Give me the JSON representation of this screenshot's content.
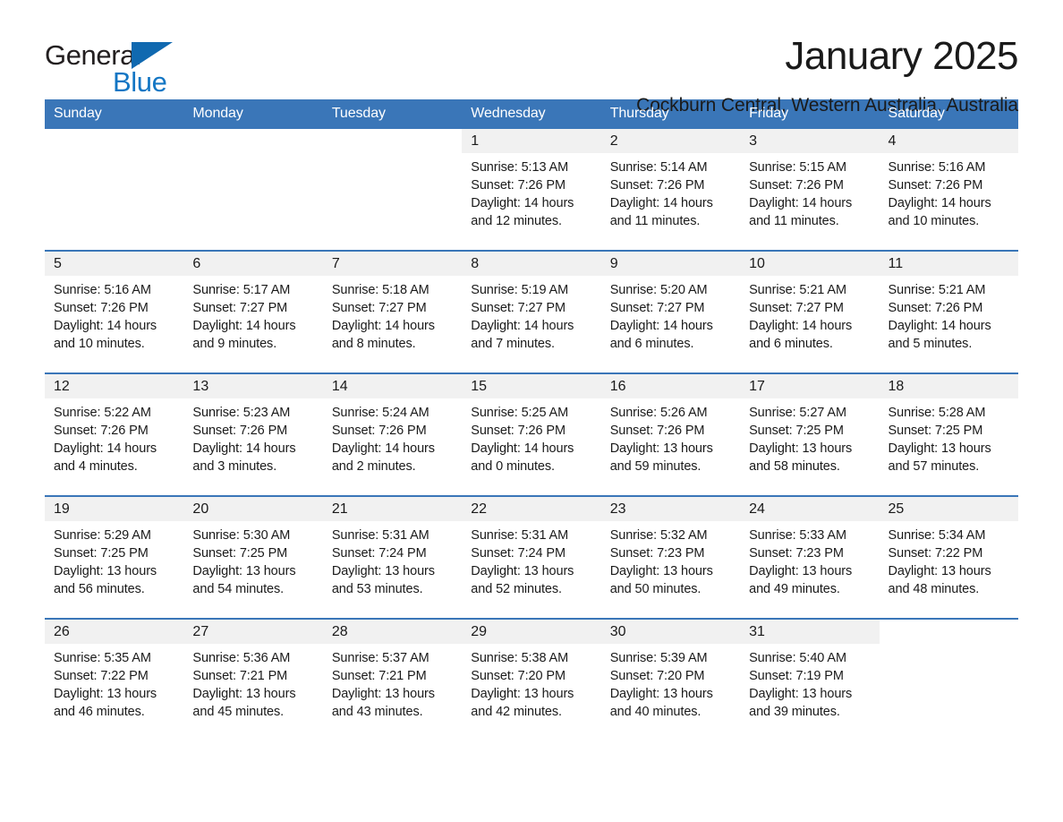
{
  "brand": {
    "name_part1": "General",
    "name_part2": "Blue",
    "accent_color": "#1376c4",
    "triangle_color": "#1069b0"
  },
  "header": {
    "title": "January 2025",
    "location": "Cockburn Central, Western Australia, Australia"
  },
  "calendar": {
    "header_bg": "#3a76b8",
    "daynum_bg": "#f1f1f1",
    "weekday_headers": [
      "Sunday",
      "Monday",
      "Tuesday",
      "Wednesday",
      "Thursday",
      "Friday",
      "Saturday"
    ],
    "weeks": [
      [
        {
          "day": "",
          "blank": true
        },
        {
          "day": "",
          "blank": true
        },
        {
          "day": "",
          "blank": true
        },
        {
          "day": "1",
          "sunrise": "Sunrise: 5:13 AM",
          "sunset": "Sunset: 7:26 PM",
          "daylight_line1": "Daylight: 14 hours",
          "daylight_line2": "and 12 minutes."
        },
        {
          "day": "2",
          "sunrise": "Sunrise: 5:14 AM",
          "sunset": "Sunset: 7:26 PM",
          "daylight_line1": "Daylight: 14 hours",
          "daylight_line2": "and 11 minutes."
        },
        {
          "day": "3",
          "sunrise": "Sunrise: 5:15 AM",
          "sunset": "Sunset: 7:26 PM",
          "daylight_line1": "Daylight: 14 hours",
          "daylight_line2": "and 11 minutes."
        },
        {
          "day": "4",
          "sunrise": "Sunrise: 5:16 AM",
          "sunset": "Sunset: 7:26 PM",
          "daylight_line1": "Daylight: 14 hours",
          "daylight_line2": "and 10 minutes."
        }
      ],
      [
        {
          "day": "5",
          "sunrise": "Sunrise: 5:16 AM",
          "sunset": "Sunset: 7:26 PM",
          "daylight_line1": "Daylight: 14 hours",
          "daylight_line2": "and 10 minutes."
        },
        {
          "day": "6",
          "sunrise": "Sunrise: 5:17 AM",
          "sunset": "Sunset: 7:27 PM",
          "daylight_line1": "Daylight: 14 hours",
          "daylight_line2": "and 9 minutes."
        },
        {
          "day": "7",
          "sunrise": "Sunrise: 5:18 AM",
          "sunset": "Sunset: 7:27 PM",
          "daylight_line1": "Daylight: 14 hours",
          "daylight_line2": "and 8 minutes."
        },
        {
          "day": "8",
          "sunrise": "Sunrise: 5:19 AM",
          "sunset": "Sunset: 7:27 PM",
          "daylight_line1": "Daylight: 14 hours",
          "daylight_line2": "and 7 minutes."
        },
        {
          "day": "9",
          "sunrise": "Sunrise: 5:20 AM",
          "sunset": "Sunset: 7:27 PM",
          "daylight_line1": "Daylight: 14 hours",
          "daylight_line2": "and 6 minutes."
        },
        {
          "day": "10",
          "sunrise": "Sunrise: 5:21 AM",
          "sunset": "Sunset: 7:27 PM",
          "daylight_line1": "Daylight: 14 hours",
          "daylight_line2": "and 6 minutes."
        },
        {
          "day": "11",
          "sunrise": "Sunrise: 5:21 AM",
          "sunset": "Sunset: 7:26 PM",
          "daylight_line1": "Daylight: 14 hours",
          "daylight_line2": "and 5 minutes."
        }
      ],
      [
        {
          "day": "12",
          "sunrise": "Sunrise: 5:22 AM",
          "sunset": "Sunset: 7:26 PM",
          "daylight_line1": "Daylight: 14 hours",
          "daylight_line2": "and 4 minutes."
        },
        {
          "day": "13",
          "sunrise": "Sunrise: 5:23 AM",
          "sunset": "Sunset: 7:26 PM",
          "daylight_line1": "Daylight: 14 hours",
          "daylight_line2": "and 3 minutes."
        },
        {
          "day": "14",
          "sunrise": "Sunrise: 5:24 AM",
          "sunset": "Sunset: 7:26 PM",
          "daylight_line1": "Daylight: 14 hours",
          "daylight_line2": "and 2 minutes."
        },
        {
          "day": "15",
          "sunrise": "Sunrise: 5:25 AM",
          "sunset": "Sunset: 7:26 PM",
          "daylight_line1": "Daylight: 14 hours",
          "daylight_line2": "and 0 minutes."
        },
        {
          "day": "16",
          "sunrise": "Sunrise: 5:26 AM",
          "sunset": "Sunset: 7:26 PM",
          "daylight_line1": "Daylight: 13 hours",
          "daylight_line2": "and 59 minutes."
        },
        {
          "day": "17",
          "sunrise": "Sunrise: 5:27 AM",
          "sunset": "Sunset: 7:25 PM",
          "daylight_line1": "Daylight: 13 hours",
          "daylight_line2": "and 58 minutes."
        },
        {
          "day": "18",
          "sunrise": "Sunrise: 5:28 AM",
          "sunset": "Sunset: 7:25 PM",
          "daylight_line1": "Daylight: 13 hours",
          "daylight_line2": "and 57 minutes."
        }
      ],
      [
        {
          "day": "19",
          "sunrise": "Sunrise: 5:29 AM",
          "sunset": "Sunset: 7:25 PM",
          "daylight_line1": "Daylight: 13 hours",
          "daylight_line2": "and 56 minutes."
        },
        {
          "day": "20",
          "sunrise": "Sunrise: 5:30 AM",
          "sunset": "Sunset: 7:25 PM",
          "daylight_line1": "Daylight: 13 hours",
          "daylight_line2": "and 54 minutes."
        },
        {
          "day": "21",
          "sunrise": "Sunrise: 5:31 AM",
          "sunset": "Sunset: 7:24 PM",
          "daylight_line1": "Daylight: 13 hours",
          "daylight_line2": "and 53 minutes."
        },
        {
          "day": "22",
          "sunrise": "Sunrise: 5:31 AM",
          "sunset": "Sunset: 7:24 PM",
          "daylight_line1": "Daylight: 13 hours",
          "daylight_line2": "and 52 minutes."
        },
        {
          "day": "23",
          "sunrise": "Sunrise: 5:32 AM",
          "sunset": "Sunset: 7:23 PM",
          "daylight_line1": "Daylight: 13 hours",
          "daylight_line2": "and 50 minutes."
        },
        {
          "day": "24",
          "sunrise": "Sunrise: 5:33 AM",
          "sunset": "Sunset: 7:23 PM",
          "daylight_line1": "Daylight: 13 hours",
          "daylight_line2": "and 49 minutes."
        },
        {
          "day": "25",
          "sunrise": "Sunrise: 5:34 AM",
          "sunset": "Sunset: 7:22 PM",
          "daylight_line1": "Daylight: 13 hours",
          "daylight_line2": "and 48 minutes."
        }
      ],
      [
        {
          "day": "26",
          "sunrise": "Sunrise: 5:35 AM",
          "sunset": "Sunset: 7:22 PM",
          "daylight_line1": "Daylight: 13 hours",
          "daylight_line2": "and 46 minutes."
        },
        {
          "day": "27",
          "sunrise": "Sunrise: 5:36 AM",
          "sunset": "Sunset: 7:21 PM",
          "daylight_line1": "Daylight: 13 hours",
          "daylight_line2": "and 45 minutes."
        },
        {
          "day": "28",
          "sunrise": "Sunrise: 5:37 AM",
          "sunset": "Sunset: 7:21 PM",
          "daylight_line1": "Daylight: 13 hours",
          "daylight_line2": "and 43 minutes."
        },
        {
          "day": "29",
          "sunrise": "Sunrise: 5:38 AM",
          "sunset": "Sunset: 7:20 PM",
          "daylight_line1": "Daylight: 13 hours",
          "daylight_line2": "and 42 minutes."
        },
        {
          "day": "30",
          "sunrise": "Sunrise: 5:39 AM",
          "sunset": "Sunset: 7:20 PM",
          "daylight_line1": "Daylight: 13 hours",
          "daylight_line2": "and 40 minutes."
        },
        {
          "day": "31",
          "sunrise": "Sunrise: 5:40 AM",
          "sunset": "Sunset: 7:19 PM",
          "daylight_line1": "Daylight: 13 hours",
          "daylight_line2": "and 39 minutes."
        },
        {
          "day": "",
          "blank": true
        }
      ]
    ]
  }
}
